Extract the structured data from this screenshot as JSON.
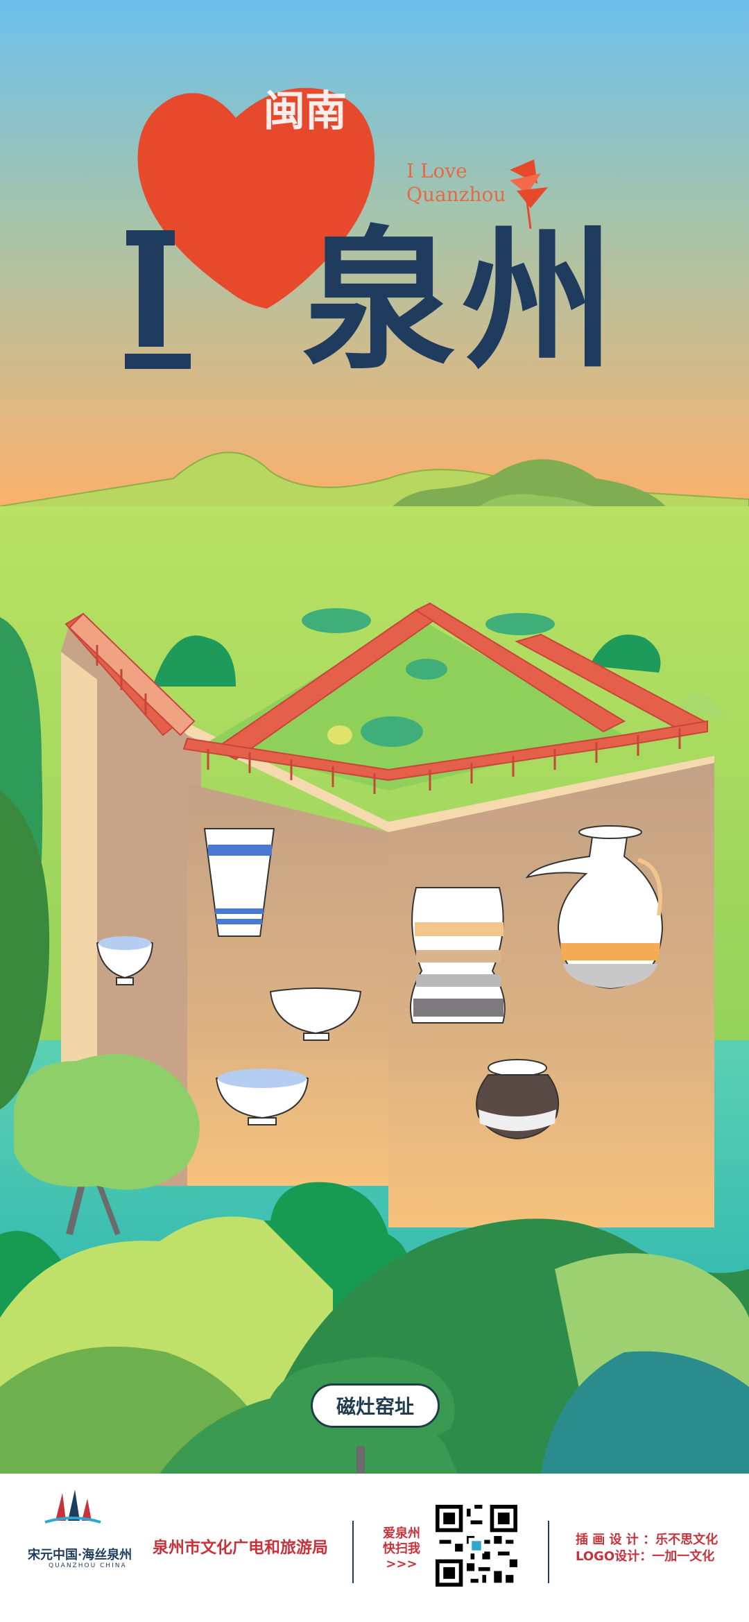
{
  "header": {
    "heart_glyph": "闽南",
    "letter_i": "I",
    "city_name": "泉州",
    "slogan_line1": "I Love",
    "slogan_line2": "Quanzhou"
  },
  "site": {
    "tag_label": "磁灶窑址"
  },
  "footer": {
    "logo_text": "宋元中国·海丝泉州",
    "logo_sub": "QUANZHOU CHINA",
    "org_name": "泉州市文化广电和旅游局",
    "qr_line1": "爱泉州",
    "qr_line2": "快扫我",
    "qr_line3": ">>>",
    "credit_illustration": "插 画 设 计 ：乐不思文化",
    "credit_logo": "LOGO设计：一加一文化"
  },
  "colors": {
    "sky_top": "#6cc0ec",
    "sky_bottom": "#fdb06a",
    "heart": "#e6492b",
    "title": "#1f3c5f",
    "roof": "#e5604b",
    "wall": "#c7a487",
    "grass": "#a6d84f",
    "footer_red": "#c8323a"
  }
}
